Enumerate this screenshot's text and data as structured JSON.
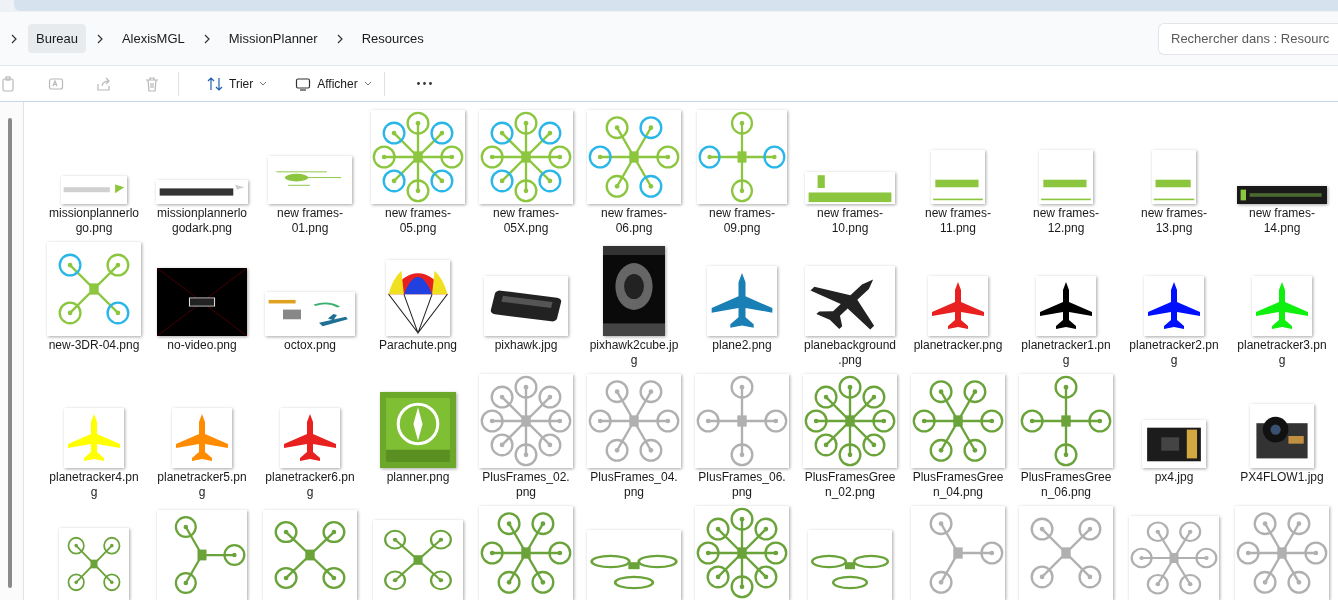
{
  "address": {
    "crumbs": [
      {
        "label": "Bureau",
        "selected": true
      },
      {
        "label": "AlexisMGL",
        "selected": false
      },
      {
        "label": "MissionPlanner",
        "selected": false
      },
      {
        "label": "Resources",
        "selected": false
      }
    ]
  },
  "search": {
    "placeholder": "Rechercher dans : Resourc"
  },
  "toolbar": {
    "buttons": [
      {
        "kind": "copy",
        "disabled": true
      },
      {
        "kind": "rename",
        "disabled": true
      },
      {
        "kind": "share",
        "disabled": true
      },
      {
        "kind": "delete",
        "disabled": true
      },
      {
        "kind": "sort",
        "label": "Trier",
        "disabled": false
      },
      {
        "kind": "view",
        "label": "Afficher",
        "disabled": false
      },
      {
        "kind": "more",
        "disabled": false
      }
    ]
  },
  "files": [
    {
      "kind": "picture",
      "name": "missionplannerlogo.png"
    },
    {
      "kind": "picture",
      "name": "missionplannerlogodark.png"
    },
    {
      "kind": "picture",
      "name": "new frames-01.png"
    },
    {
      "kind": "picture",
      "name": "new frames-05.png"
    },
    {
      "kind": "picture",
      "name": "new frames-05X.png"
    },
    {
      "kind": "picture",
      "name": "new frames-06.png"
    },
    {
      "kind": "picture",
      "name": "new frames-09.png"
    },
    {
      "kind": "picture",
      "name": "new frames-10.png"
    },
    {
      "kind": "picture",
      "name": "new frames-11.png"
    },
    {
      "kind": "picture",
      "name": "new frames-12.png"
    },
    {
      "kind": "picture",
      "name": "new frames-13.png"
    },
    {
      "kind": "picture",
      "name": "new frames-14.png"
    },
    {
      "kind": "picture",
      "name": "new-3DR-04.png"
    },
    {
      "kind": "picture",
      "name": "no-video.png"
    },
    {
      "kind": "picture",
      "name": "octox.png"
    },
    {
      "kind": "picture",
      "name": "Parachute.png"
    },
    {
      "kind": "picture",
      "name": "pixhawk.jpg"
    },
    {
      "kind": "picture",
      "name": "pixhawk2cube.jpg"
    },
    {
      "kind": "picture",
      "name": "plane2.png"
    },
    {
      "kind": "picture",
      "name": "planebackground.png"
    },
    {
      "kind": "picture",
      "name": "planetracker.png"
    },
    {
      "kind": "picture",
      "name": "planetracker1.png"
    },
    {
      "kind": "picture",
      "name": "planetracker2.png"
    },
    {
      "kind": "picture",
      "name": "planetracker3.png"
    },
    {
      "kind": "picture",
      "name": "planetracker4.png"
    },
    {
      "kind": "picture",
      "name": "planetracker5.png"
    },
    {
      "kind": "picture",
      "name": "planetracker6.png"
    },
    {
      "kind": "picture",
      "name": "planner.png"
    },
    {
      "kind": "picture",
      "name": "PlusFrames_02.png"
    },
    {
      "kind": "picture",
      "name": "PlusFrames_04.png"
    },
    {
      "kind": "picture",
      "name": "PlusFrames_06.png"
    },
    {
      "kind": "picture",
      "name": "PlusFramesGreen_02.png"
    },
    {
      "kind": "picture",
      "name": "PlusFramesGreen_04.png"
    },
    {
      "kind": "picture",
      "name": "PlusFramesGreen_06.png"
    },
    {
      "kind": "picture",
      "name": "px4.jpg"
    },
    {
      "kind": "picture",
      "name": "PX4FLOW1.jpg"
    },
    {
      "kind": "picture"
    },
    {
      "kind": "picture"
    },
    {
      "kind": "picture"
    },
    {
      "kind": "picture"
    },
    {
      "kind": "picture"
    },
    {
      "kind": "picture"
    },
    {
      "kind": "picture"
    },
    {
      "kind": "picture"
    },
    {
      "kind": "picture"
    },
    {
      "kind": "picture"
    },
    {
      "kind": "picture"
    },
    {
      "kind": "picture"
    }
  ]
}
